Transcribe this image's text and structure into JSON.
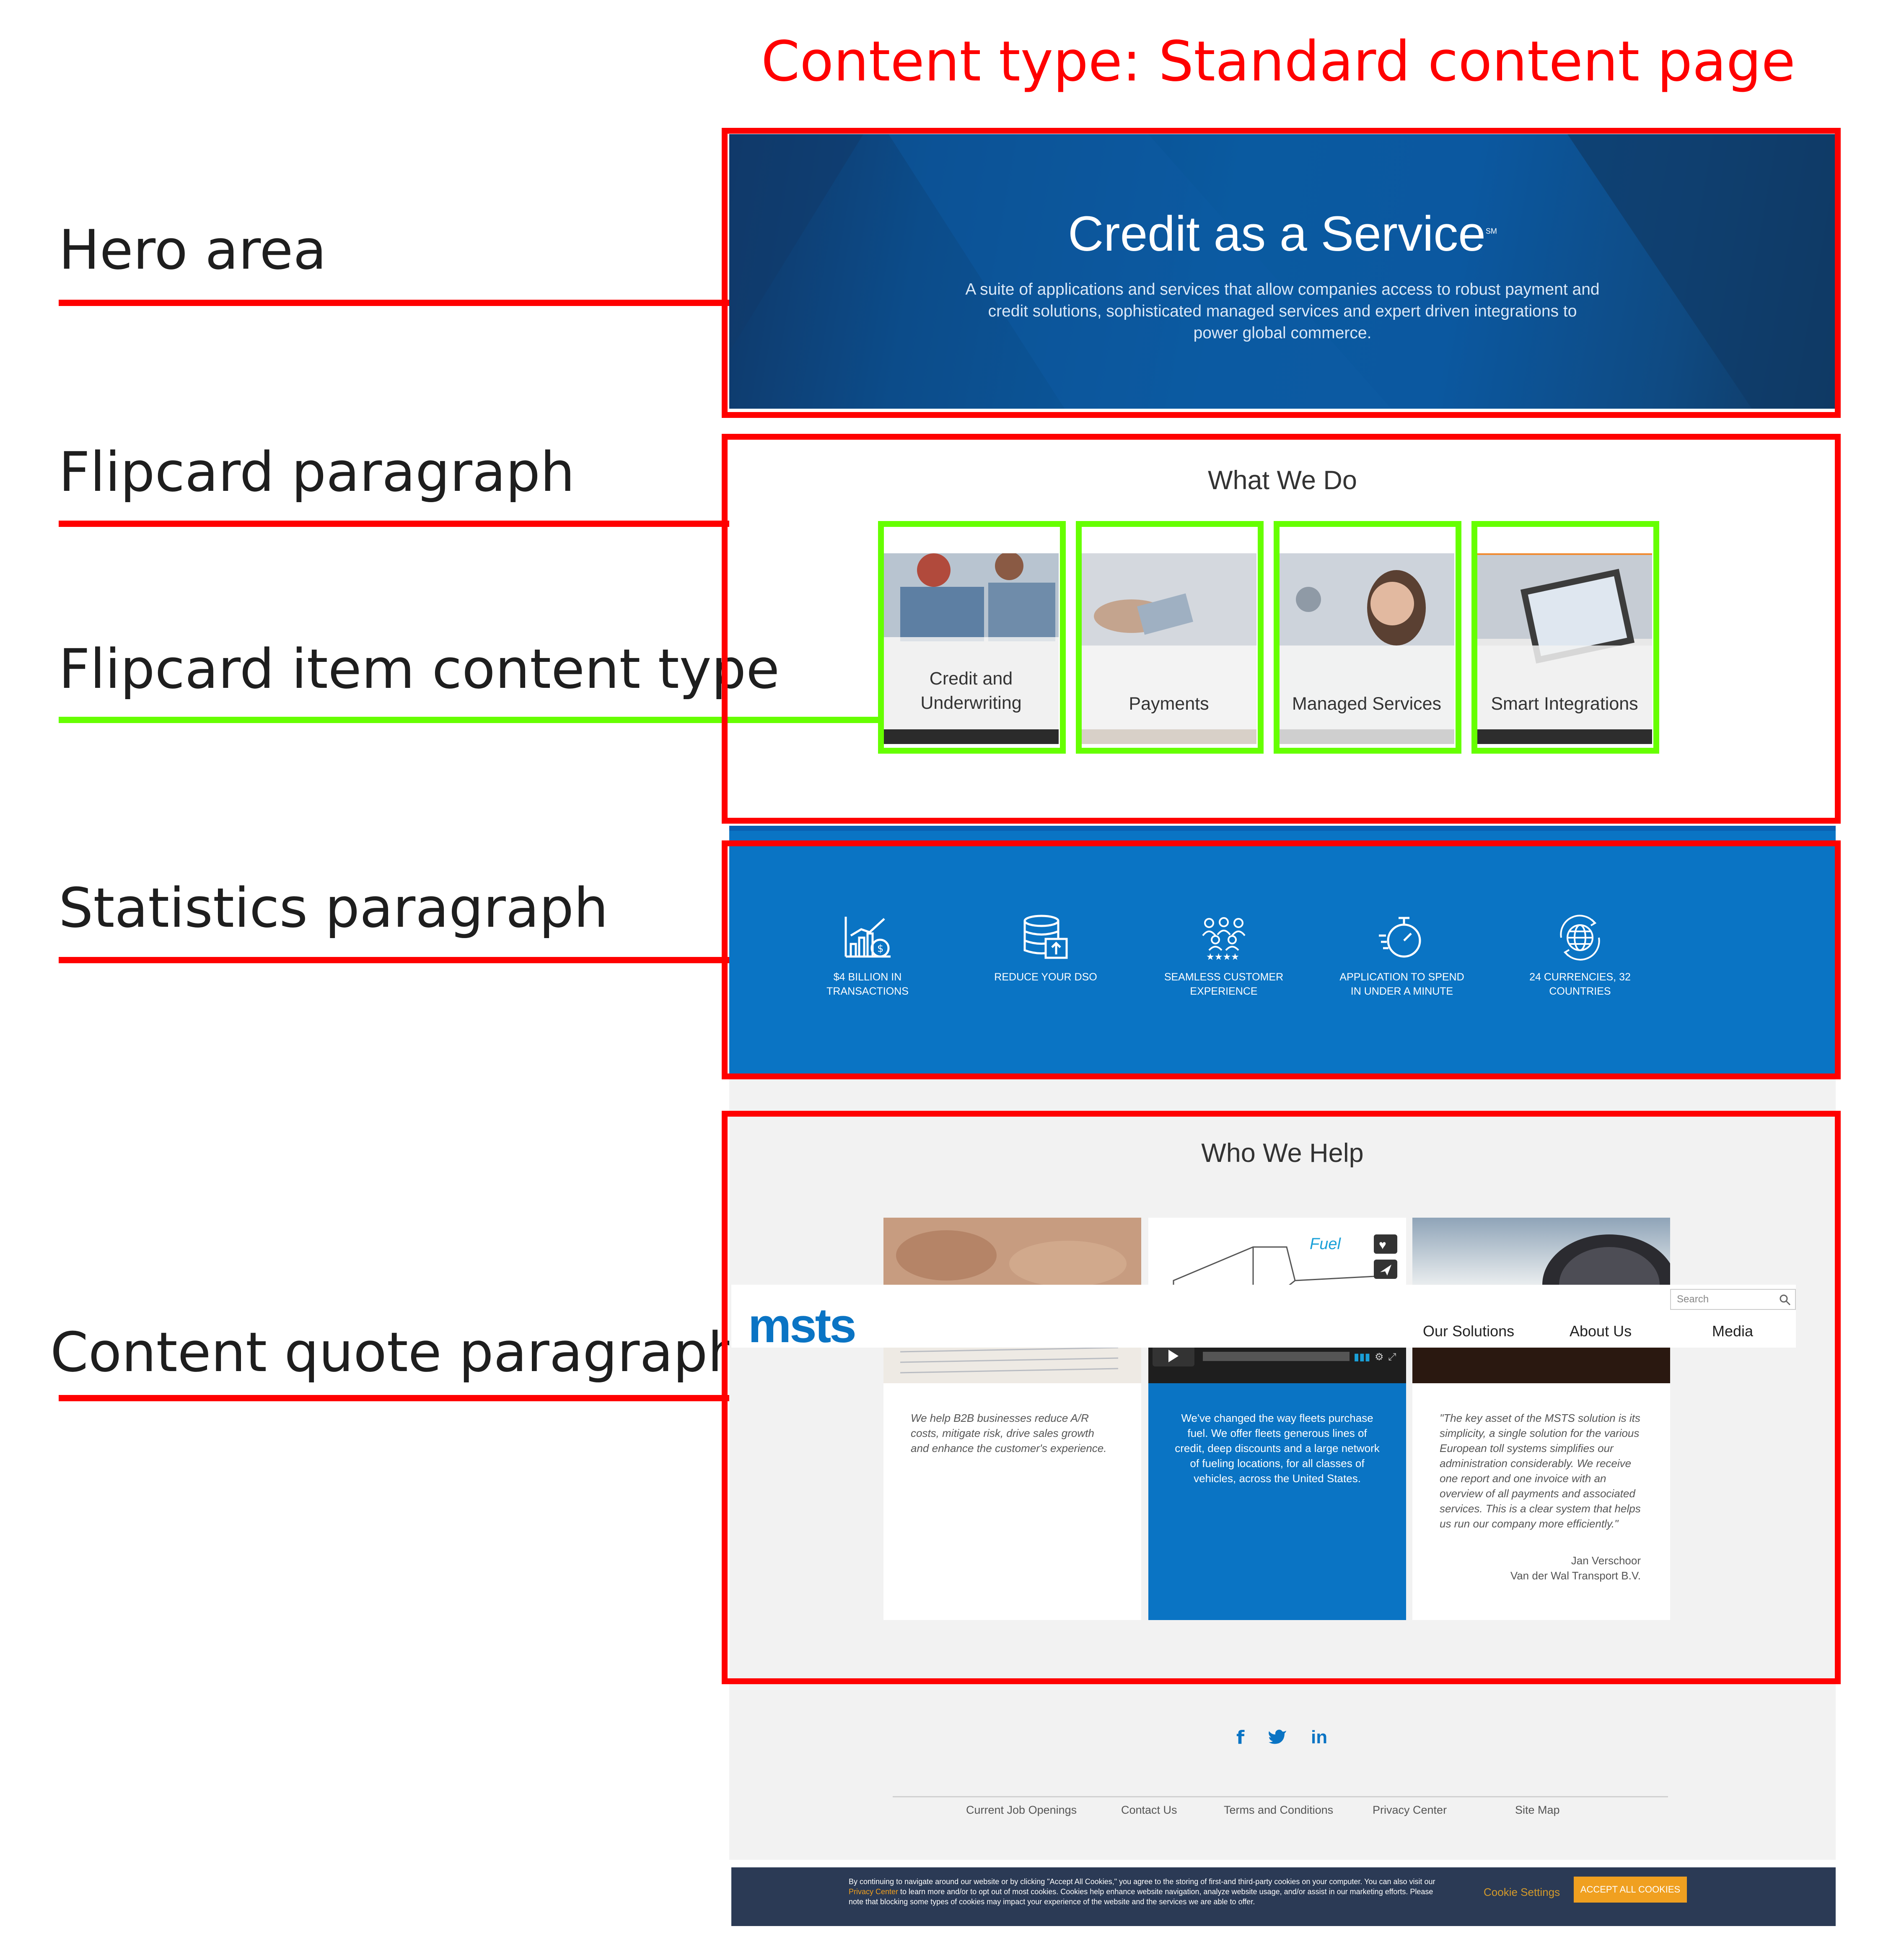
{
  "annotations": {
    "title": "Content type: Standard content page",
    "labels": {
      "hero": "Hero area",
      "flipcard": "Flipcard paragraph",
      "flipcard_item": "Flipcard item content type",
      "statistics": "Statistics paragraph",
      "content_quote": "Content quote paragraph"
    },
    "colors": {
      "region": "#ff0000",
      "item": "#66ff00"
    }
  },
  "hero": {
    "title": "Credit as a Service",
    "title_mark": "SM",
    "description": "A suite of applications and services that allow companies access to robust payment and credit solutions, sophisticated managed services and expert driven integrations to power global commerce."
  },
  "what_we_do": {
    "title": "What We Do",
    "cards": [
      {
        "label_line1": "Credit and",
        "label_line2": "Underwriting"
      },
      {
        "label_line1": "",
        "label_line2": "Payments"
      },
      {
        "label_line1": "",
        "label_line2": "Managed Services"
      },
      {
        "label_line1": "",
        "label_line2": "Smart Integrations"
      }
    ]
  },
  "statistics": {
    "items": [
      {
        "icon": "chart-growth-icon",
        "line1": "$4 BILLION IN",
        "line2": "TRANSACTIONS"
      },
      {
        "icon": "database-upload-icon",
        "line1": "REDUCE YOUR DSO",
        "line2": ""
      },
      {
        "icon": "customer-group-icon",
        "line1": "SEAMLESS CUSTOMER",
        "line2": "EXPERIENCE"
      },
      {
        "icon": "stopwatch-icon",
        "line1": "APPLICATION TO SPEND",
        "line2": "IN UNDER A MINUTE"
      },
      {
        "icon": "globe-icon",
        "line1": "24 CURRENCIES, 32",
        "line2": "COUNTRIES"
      }
    ]
  },
  "who_we_help": {
    "title": "Who We Help",
    "cards": [
      {
        "text": "We help B2B businesses reduce A/R costs, mitigate risk, drive sales growth and enhance the customer's experience."
      },
      {
        "video_label": "Fuel",
        "text": "We've changed the way fleets purchase fuel. We offer fleets generous lines of credit, deep discounts and a large network of fueling locations, for all classes of vehicles, across the United States."
      },
      {
        "text": "\"The key asset of the MSTS solution is its simplicity, a single solution for the various European toll systems simplifies our administration considerably. We receive one report and one invoice with an overview of all payments and associated services. This is a clear system that helps us run our company more efficiently.\"",
        "author": "Jan Verschoor",
        "company": "Van der Wal Transport B.V."
      }
    ]
  },
  "navbar": {
    "logo": "msts",
    "search_placeholder": "Search",
    "links": [
      "Our Solutions",
      "About Us",
      "Media"
    ]
  },
  "footer": {
    "social": [
      "f",
      "twitter",
      "in"
    ],
    "links": [
      "Current Job Openings",
      "Contact Us",
      "Terms and Conditions",
      "Privacy Center",
      "Site Map"
    ]
  },
  "cookie": {
    "text_before": "By continuing to navigate around our website or by clicking \"Accept All Cookies,\" you agree to the storing of first-and third-party cookies on your computer.  You can also visit our ",
    "link": "Privacy Center",
    "text_after": " to learn more and/or to opt out of most cookies.  Cookies help enhance website navigation, analyze website usage, and/or assist in our marketing efforts. Please note that blocking some types of cookies may impact your experience of the website and the services we are able to offer.",
    "settings": "Cookie Settings",
    "accept": "ACCEPT ALL COOKIES"
  }
}
